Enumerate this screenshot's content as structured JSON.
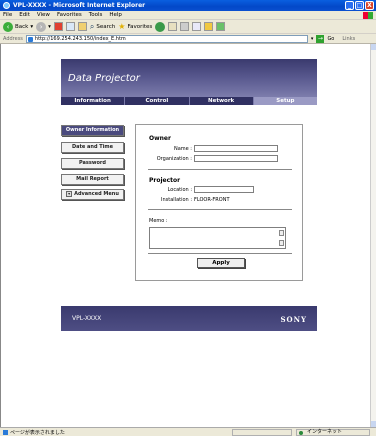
{
  "window": {
    "title": "VPL-XXXX - Microsoft Internet Explorer",
    "min": "_",
    "max": "□",
    "close": "X"
  },
  "menu": [
    "File",
    "Edit",
    "View",
    "Favorites",
    "Tools",
    "Help"
  ],
  "toolbar": {
    "back": "Back",
    "search": "Search",
    "favorites": "Favorites"
  },
  "address": {
    "label": "Address",
    "url": "http://169.254.243.150/index_E.htm",
    "go": "Go",
    "links": "Links"
  },
  "banner": {
    "title": "Data Projector",
    "tabs": [
      "Information",
      "Control",
      "Network",
      "Setup"
    ],
    "active_tab": "Setup"
  },
  "sidebar": {
    "items": [
      "Owner Information",
      "Date and Time",
      "Password",
      "Mail Report",
      "Advanced Menu"
    ]
  },
  "form": {
    "owner_title": "Owner",
    "name_label": "Name :",
    "organization_label": "Organization :",
    "projector_title": "Projector",
    "location_label": "Location :",
    "installation_label": "Installation :",
    "installation_value": "FLOOR-FRONT",
    "memo_label": "Memo :",
    "apply": "Apply"
  },
  "footer": {
    "model": "VPL-XXXX",
    "brand": "SONY"
  },
  "status": {
    "text": "ページが表示されました",
    "zone": "インターネット"
  }
}
